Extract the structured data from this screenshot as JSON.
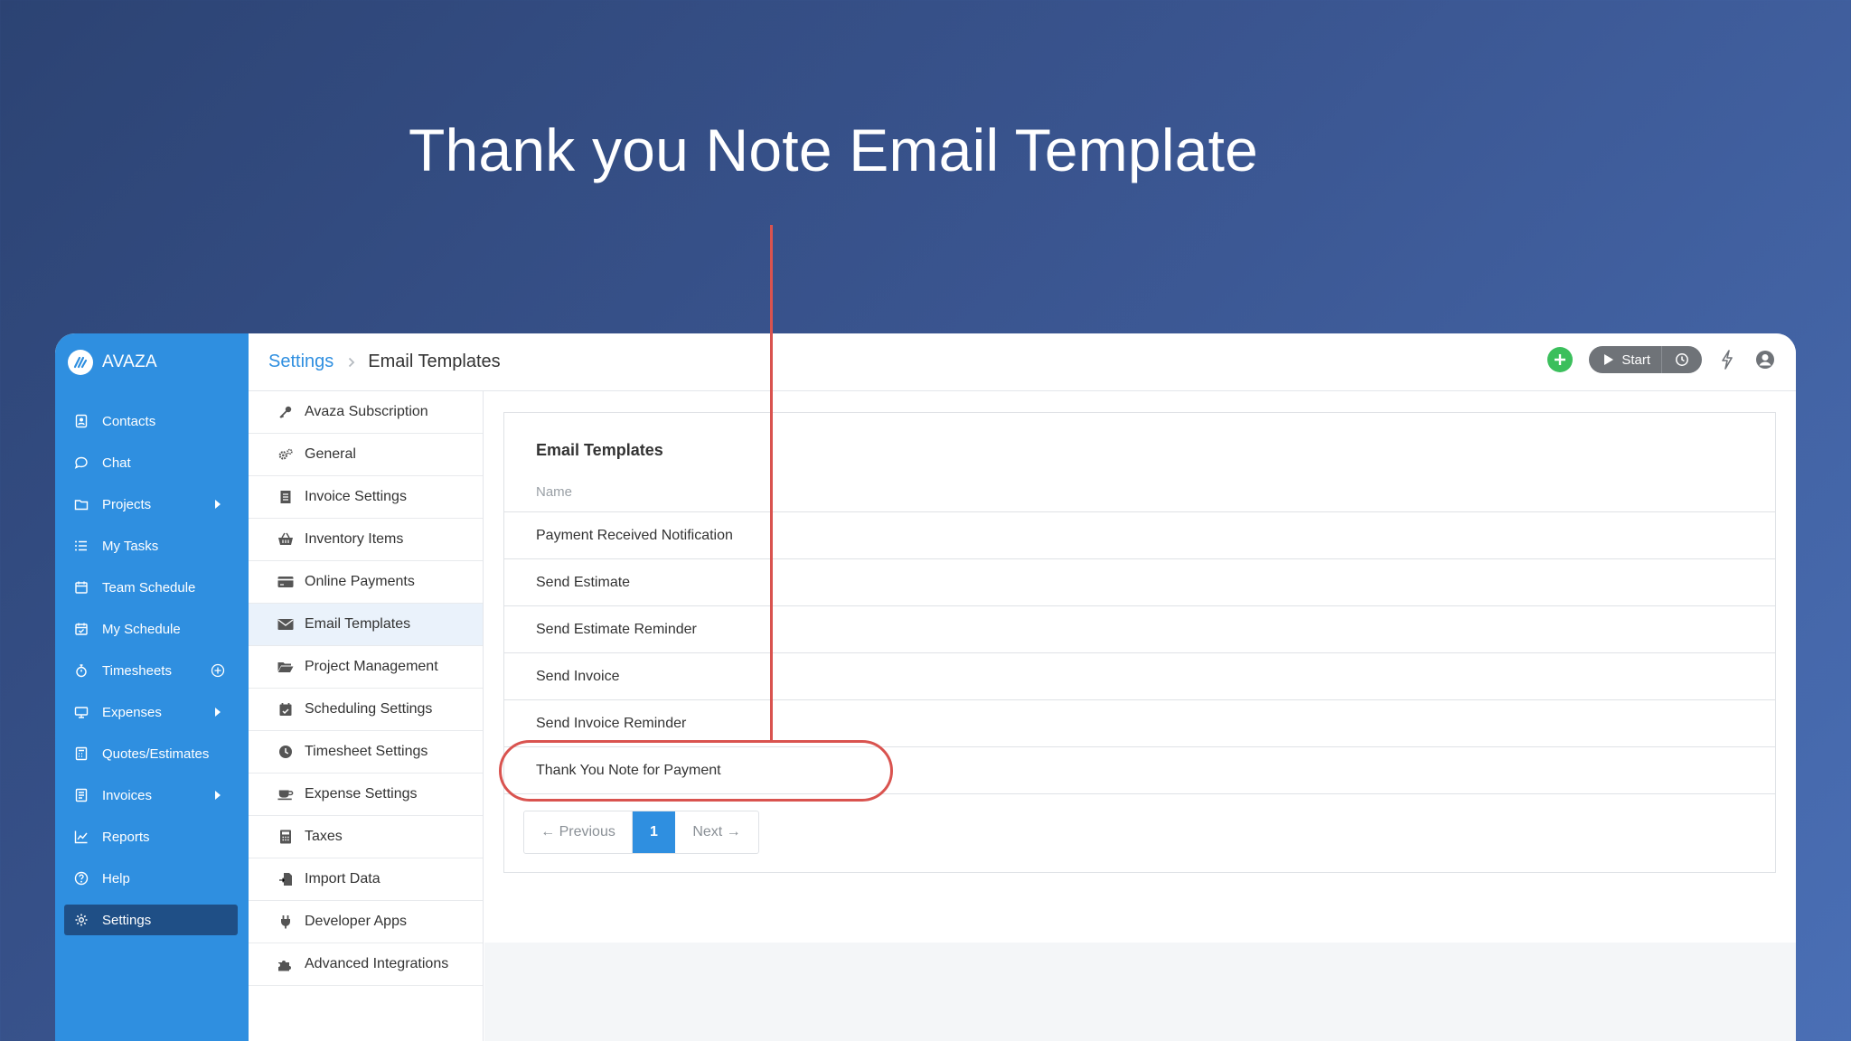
{
  "headline": "Thank you Note Email Template",
  "colors": {
    "sidebar": "#2f8fe0",
    "sidebar_active": "#1f4f86",
    "accent": "#2f8fe0",
    "add_button": "#3bbf5c",
    "annotation": "#d9534f"
  },
  "brand": {
    "name": "AVAZA",
    "icon": "avaza-logo-icon"
  },
  "sidebar": {
    "items": [
      {
        "label": "Contacts",
        "icon": "contacts-icon"
      },
      {
        "label": "Chat",
        "icon": "chat-icon"
      },
      {
        "label": "Projects",
        "icon": "folder-icon",
        "trail": "caret-right-icon"
      },
      {
        "label": "My Tasks",
        "icon": "tasks-icon"
      },
      {
        "label": "Team Schedule",
        "icon": "calendar-icon"
      },
      {
        "label": "My Schedule",
        "icon": "calendar-check-icon"
      },
      {
        "label": "Timesheets",
        "icon": "stopwatch-icon",
        "trail": "plus-circle-icon"
      },
      {
        "label": "Expenses",
        "icon": "expenses-icon",
        "trail": "caret-right-icon"
      },
      {
        "label": "Quotes/Estimates",
        "icon": "calculator-icon"
      },
      {
        "label": "Invoices",
        "icon": "invoice-icon",
        "trail": "caret-right-icon"
      },
      {
        "label": "Reports",
        "icon": "chart-icon"
      },
      {
        "label": "Help",
        "icon": "help-icon"
      },
      {
        "label": "Settings",
        "icon": "gear-icon",
        "active": true
      }
    ]
  },
  "breadcrumb": {
    "parent": "Settings",
    "current": "Email Templates"
  },
  "topbar": {
    "start_label": "Start"
  },
  "settings_menu": {
    "items": [
      {
        "label": "Avaza Subscription",
        "icon": "key-icon"
      },
      {
        "label": "General",
        "icon": "gears-icon"
      },
      {
        "label": "Invoice Settings",
        "icon": "document-icon"
      },
      {
        "label": "Inventory Items",
        "icon": "basket-icon"
      },
      {
        "label": "Online Payments",
        "icon": "credit-card-icon"
      },
      {
        "label": "Email Templates",
        "icon": "envelope-icon",
        "active": true
      },
      {
        "label": "Project Management",
        "icon": "folder-open-icon"
      },
      {
        "label": "Scheduling Settings",
        "icon": "calendar-icon"
      },
      {
        "label": "Timesheet Settings",
        "icon": "clock-icon"
      },
      {
        "label": "Expense Settings",
        "icon": "coffee-icon"
      },
      {
        "label": "Taxes",
        "icon": "calculator-icon"
      },
      {
        "label": "Import Data",
        "icon": "import-icon"
      },
      {
        "label": "Developer Apps",
        "icon": "plug-icon"
      },
      {
        "label": "Advanced Integrations",
        "icon": "puzzle-icon"
      }
    ]
  },
  "templates": {
    "title": "Email Templates",
    "column": "Name",
    "rows": [
      "Payment Received Notification",
      "Send Estimate",
      "Send Estimate Reminder",
      "Send Invoice",
      "Send Invoice Reminder",
      "Thank You Note for Payment"
    ]
  },
  "pagination": {
    "previous": "← Previous",
    "current": "1",
    "next": "Next →"
  }
}
